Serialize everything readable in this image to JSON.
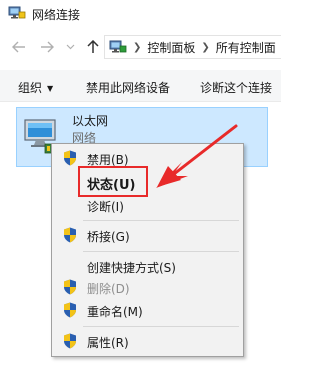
{
  "window": {
    "title": "网络连接",
    "icon": "network-connections-icon"
  },
  "addressbar": {
    "back_icon": "back-arrow-icon",
    "forward_icon": "forward-arrow-icon",
    "recent_icon": "chevron-down-icon",
    "up_icon": "up-arrow-icon",
    "breadcrumbs": [
      "控制面板",
      "所有控制面"
    ]
  },
  "commandbar": {
    "organize": "组织",
    "disable_device": "禁用此网络设备",
    "diagnose": "诊断这个连接"
  },
  "adapter": {
    "name": "以太网",
    "status": "网络",
    "icon": "ethernet-adapter-icon"
  },
  "context_menu": {
    "items": [
      {
        "label": "禁用(B)",
        "shield": true,
        "disabled": false,
        "bold": false
      },
      {
        "label": "状态(U)",
        "shield": false,
        "disabled": false,
        "bold": true
      },
      {
        "label": "诊断(I)",
        "shield": false,
        "disabled": false,
        "bold": false
      },
      {
        "label": "桥接(G)",
        "shield": true,
        "disabled": false,
        "bold": false
      },
      {
        "label": "创建快捷方式(S)",
        "shield": false,
        "disabled": false,
        "bold": false
      },
      {
        "label": "删除(D)",
        "shield": true,
        "disabled": true,
        "bold": false
      },
      {
        "label": "重命名(M)",
        "shield": true,
        "disabled": false,
        "bold": false
      },
      {
        "label": "属性(R)",
        "shield": true,
        "disabled": false,
        "bold": false
      }
    ]
  },
  "annotation": {
    "color": "#e82a2a",
    "highlighted_item": "状态(U)"
  }
}
